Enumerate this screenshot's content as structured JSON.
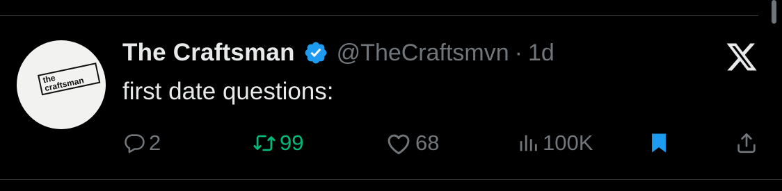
{
  "tweet": {
    "author_name": "The Craftsman",
    "handle": "@TheCraftsmvn",
    "separator": "·",
    "age": "1d",
    "text": "first date questions:",
    "avatar": {
      "line1": "the",
      "line2": "craftsman"
    }
  },
  "actions": {
    "replies": "2",
    "retweets": "99",
    "likes": "68",
    "views": "100K"
  },
  "icons": {
    "verified": "verified-badge-icon",
    "brand": "x-logo-icon",
    "reply": "reply-icon",
    "retweet": "retweet-icon",
    "like": "heart-icon",
    "views": "views-icon",
    "bookmark": "bookmark-icon",
    "share": "share-icon"
  },
  "colors": {
    "background": "#000000",
    "text": "#e7e9ea",
    "muted": "#71767b",
    "verified": "#1d9bf0",
    "retweet_active": "#00ba7c",
    "bookmark_active": "#1d9bf0"
  }
}
